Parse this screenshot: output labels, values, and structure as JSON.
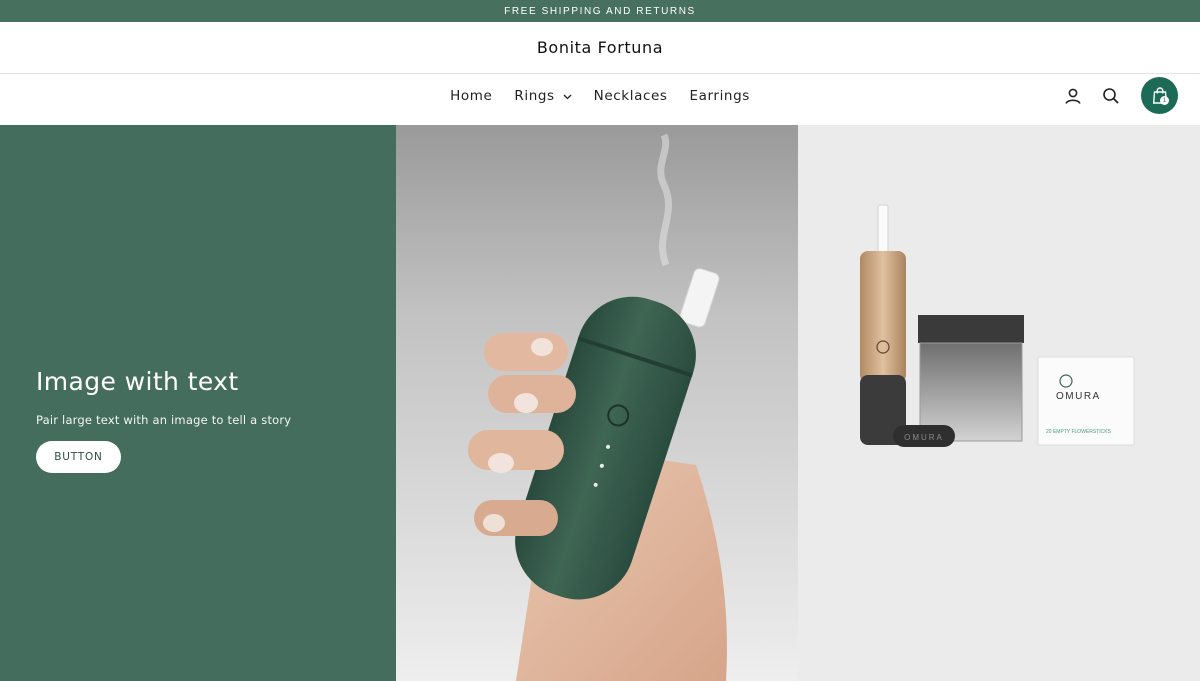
{
  "announcement": {
    "text": "FREE SHIPPING AND RETURNS"
  },
  "header": {
    "logo": "Bonita Fortuna"
  },
  "nav": {
    "links": [
      {
        "label": "Home"
      },
      {
        "label": "Rings"
      },
      {
        "label": "Necklaces"
      },
      {
        "label": "Earrings"
      }
    ],
    "cart_count": "1"
  },
  "hero": {
    "title": "Image with text",
    "subtitle": "Pair large text with an image to tell a story",
    "button_label": "BUTTON"
  },
  "product": {
    "pack_brand": "OMURA",
    "pack_line": "20 EMPTY FLOWERSTICKS",
    "case_label": "OMURA"
  },
  "colors": {
    "announcement_bg": "#47705f",
    "hero_panel_bg": "#446d5e",
    "cart_bg": "#1c6b57",
    "device_green": "#3f6553"
  },
  "icons": {
    "account": "user-icon",
    "search": "search-icon",
    "cart": "shopping-bag-icon",
    "dropdown": "chevron-down-icon"
  }
}
